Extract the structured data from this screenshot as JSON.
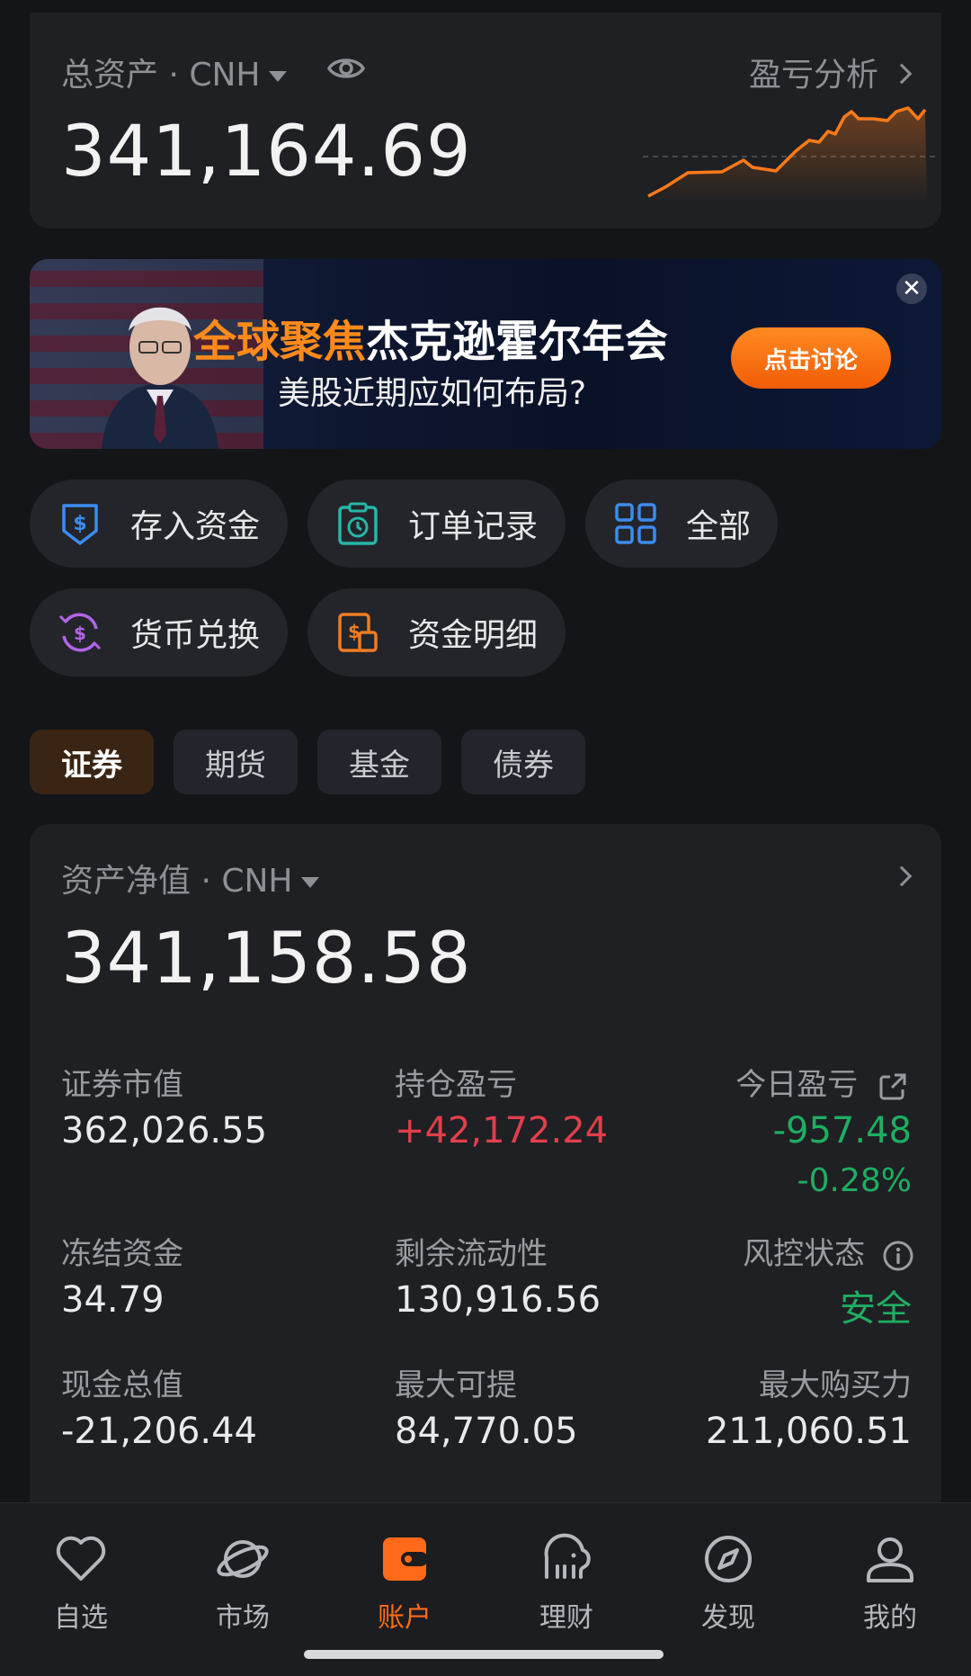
{
  "summary": {
    "total_label": "总资产 · CNH",
    "total_value": "341,164.69",
    "pl_analysis": "盈亏分析"
  },
  "banner": {
    "title_highlight": "全球聚焦",
    "title_rest": "杰克逊霍尔年会",
    "subtitle": "美股近期应如何布局?",
    "cta": "点击讨论",
    "close": "✕"
  },
  "actions": [
    {
      "label": "存入资金",
      "icon": "deposit-icon"
    },
    {
      "label": "订单记录",
      "icon": "order-icon"
    },
    {
      "label": "全部",
      "icon": "grid-icon"
    },
    {
      "label": "货币兑换",
      "icon": "exchange-icon"
    },
    {
      "label": "资金明细",
      "icon": "fund-detail-icon"
    }
  ],
  "tabs": [
    {
      "label": "证券",
      "active": true
    },
    {
      "label": "期货",
      "active": false
    },
    {
      "label": "基金",
      "active": false
    },
    {
      "label": "债券",
      "active": false
    }
  ],
  "account": {
    "net_label": "资产净值 · CNH",
    "net_value": "341,158.58",
    "stats": {
      "market_value_label": "证券市值",
      "market_value": "362,026.55",
      "position_pl_label": "持仓盈亏",
      "position_pl": "+42,172.24",
      "today_pl_label": "今日盈亏",
      "today_pl": "-957.48",
      "today_pl_pct": "-0.28%",
      "frozen_label": "冻结资金",
      "frozen": "34.79",
      "liquidity_label": "剩余流动性",
      "liquidity": "130,916.56",
      "risk_label": "风控状态",
      "risk": "安全",
      "cash_label": "现金总值",
      "cash": "-21,206.44",
      "max_withdraw_label": "最大可提",
      "max_withdraw": "84,770.05",
      "max_buy_label": "最大购买力",
      "max_buy": "211,060.51"
    }
  },
  "nav": [
    {
      "label": "自选",
      "icon": "heart-icon",
      "active": false
    },
    {
      "label": "市场",
      "icon": "planet-icon",
      "active": false
    },
    {
      "label": "账户",
      "icon": "wallet-icon",
      "active": true
    },
    {
      "label": "理财",
      "icon": "elephant-icon",
      "active": false
    },
    {
      "label": "发现",
      "icon": "compass-icon",
      "active": false
    },
    {
      "label": "我的",
      "icon": "user-icon",
      "active": false
    }
  ],
  "colors": {
    "accent": "#ff6a1a",
    "up": "#e23e4c",
    "down": "#1fae62",
    "background": "#141518",
    "card": "#1f2023"
  }
}
